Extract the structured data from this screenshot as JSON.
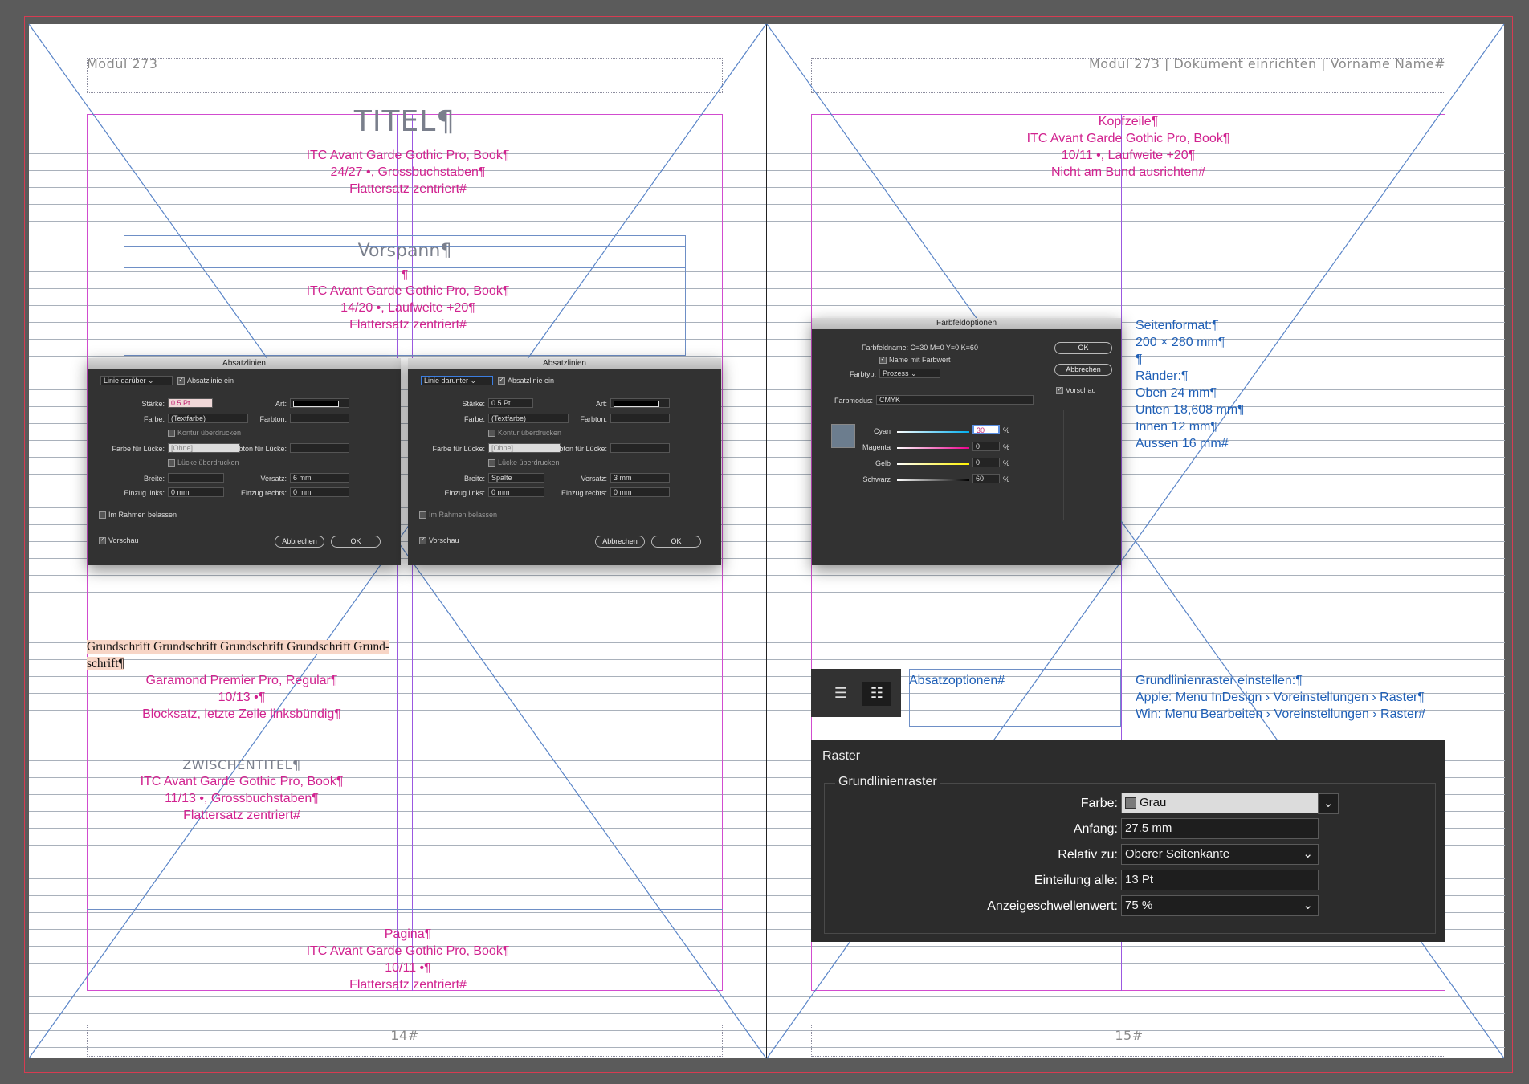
{
  "left_page": {
    "header": "Modul 273",
    "title": "TITEL¶",
    "title_spec": [
      "ITC Avant Garde Gothic Pro, Book¶",
      "24/27 •, Grossbuchstaben¶",
      "Flattersatz zentriert#"
    ],
    "vorspann": "Vorspann¶",
    "pilcrow": "¶",
    "vorspann_spec": [
      "ITC Avant Garde Gothic Pro, Book¶",
      "14/20 •, Laufweite +20¶",
      "Flattersatz zentriert#"
    ],
    "body_sample": [
      "Grundschrift Grundschrift Grundschrift Grundschrift Grund-",
      "schrift¶"
    ],
    "body_spec": [
      "Garamond Premier Pro, Regular¶",
      "10/13 •¶",
      "Blocksatz, letzte Zeile linksbündig¶"
    ],
    "zwischentitel": "ZWISCHENTITEL¶",
    "zwischentitel_spec": [
      "ITC Avant Garde Gothic Pro, Book¶",
      "11/13 •, Grossbuchstaben¶",
      "Flattersatz zentriert#"
    ],
    "pagina_spec": [
      "Pagina¶",
      "ITC Avant Garde Gothic Pro, Book¶",
      "10/11 •¶",
      "Flattersatz zentriert#"
    ],
    "page_number": "14#"
  },
  "right_page": {
    "header": "Modul 273 | Dokument einrichten | Vorname Name#",
    "kopfzeile_spec": [
      "Kopfzeile¶",
      "ITC Avant Garde Gothic Pro, Book¶",
      "10/11 •, Laufweite +20¶",
      "Nicht am Bund ausrichten#"
    ],
    "format_spec": [
      "Seitenformat:¶",
      "200 × 280 mm¶",
      "¶",
      "Ränder:¶",
      "Oben 24 mm¶",
      "Unten 18,608 mm¶",
      "Innen 12 mm¶",
      "Aussen 16 mm#"
    ],
    "absatzoptionen": "Absatzoptionen#",
    "raster_spec": [
      "Grundlinienraster einstellen:¶",
      "Apple: Menu InDesign › Voreinstellungen › Raster¶",
      "Win: Menu Bearbeiten › Voreinstellungen › Raster#"
    ],
    "page_number": "15#"
  },
  "absatzlinien_1": {
    "title": "Absatzlinien",
    "line_select": "Linie darüber",
    "enable": "Absatzlinie ein",
    "staerke_label": "Stärke:",
    "staerke": "0.5 Pt",
    "art_label": "Art:",
    "farbe_label": "Farbe:",
    "farbe": "(Textfarbe)",
    "farbton_label": "Farbton:",
    "kontur": "Kontur überdrucken",
    "farbe_luecke_label": "Farbe für Lücke:",
    "farbe_luecke": "[Ohne]",
    "farbton_luecke_label": "Farbton für Lücke:",
    "luecke": "Lücke überdrucken",
    "breite_label": "Breite:",
    "breite": "",
    "versatz_label": "Versatz:",
    "versatz": "6 mm",
    "einzug_links_label": "Einzug links:",
    "einzug_links": "0 mm",
    "einzug_rechts_label": "Einzug rechts:",
    "einzug_rechts": "0 mm",
    "im_rahmen": "Im Rahmen belassen",
    "vorschau": "Vorschau",
    "cancel": "Abbrechen",
    "ok": "OK"
  },
  "absatzlinien_2": {
    "title": "Absatzlinien",
    "line_select": "Linie darunter",
    "enable": "Absatzlinie ein",
    "staerke_label": "Stärke:",
    "staerke": "0.5 Pt",
    "art_label": "Art:",
    "farbe_label": "Farbe:",
    "farbe": "(Textfarbe)",
    "farbton_label": "Farbton:",
    "kontur": "Kontur überdrucken",
    "farbe_luecke_label": "Farbe für Lücke:",
    "farbe_luecke": "[Ohne]",
    "farbton_luecke_label": "Farbton für Lücke:",
    "luecke": "Lücke überdrucken",
    "breite_label": "Breite:",
    "breite": "Spalte",
    "versatz_label": "Versatz:",
    "versatz": "3 mm",
    "einzug_links_label": "Einzug links:",
    "einzug_links": "0 mm",
    "einzug_rechts_label": "Einzug rechts:",
    "einzug_rechts": "0 mm",
    "im_rahmen": "Im Rahmen belassen",
    "vorschau": "Vorschau",
    "cancel": "Abbrechen",
    "ok": "OK"
  },
  "farbfeld": {
    "title": "Farbfeldoptionen",
    "name_label": "Farbfeldname:",
    "name": "C=30 M=0 Y=0 K=60",
    "name_mit_farbwert": "Name mit Farbwert",
    "farbtyp_label": "Farbtyp:",
    "farbtyp": "Prozess",
    "farbmodus_label": "Farbmodus:",
    "farbmodus": "CMYK",
    "cyan_label": "Cyan",
    "cyan": "30",
    "magenta_label": "Magenta",
    "magenta": "0",
    "gelb_label": "Gelb",
    "gelb": "0",
    "schwarz_label": "Schwarz",
    "schwarz": "60",
    "percent": "%",
    "ok": "OK",
    "cancel": "Abbrechen",
    "vorschau": "Vorschau",
    "swatch_color": "#6c7d8e"
  },
  "raster": {
    "title": "Raster",
    "group": "Grundlinienraster",
    "farbe_label": "Farbe:",
    "farbe": "Grau",
    "anfang_label": "Anfang:",
    "anfang": "27.5 mm",
    "relativ_label": "Relativ zu:",
    "relativ": "Oberer Seitenkante",
    "einteilung_label": "Einteilung alle:",
    "einteilung": "13 Pt",
    "schwelle_label": "Anzeigeschwellenwert:",
    "schwelle": "75 %"
  },
  "colors": {
    "magenta": "#d1228f",
    "blue": "#1f5fb6",
    "guide": "#d14ccf"
  }
}
